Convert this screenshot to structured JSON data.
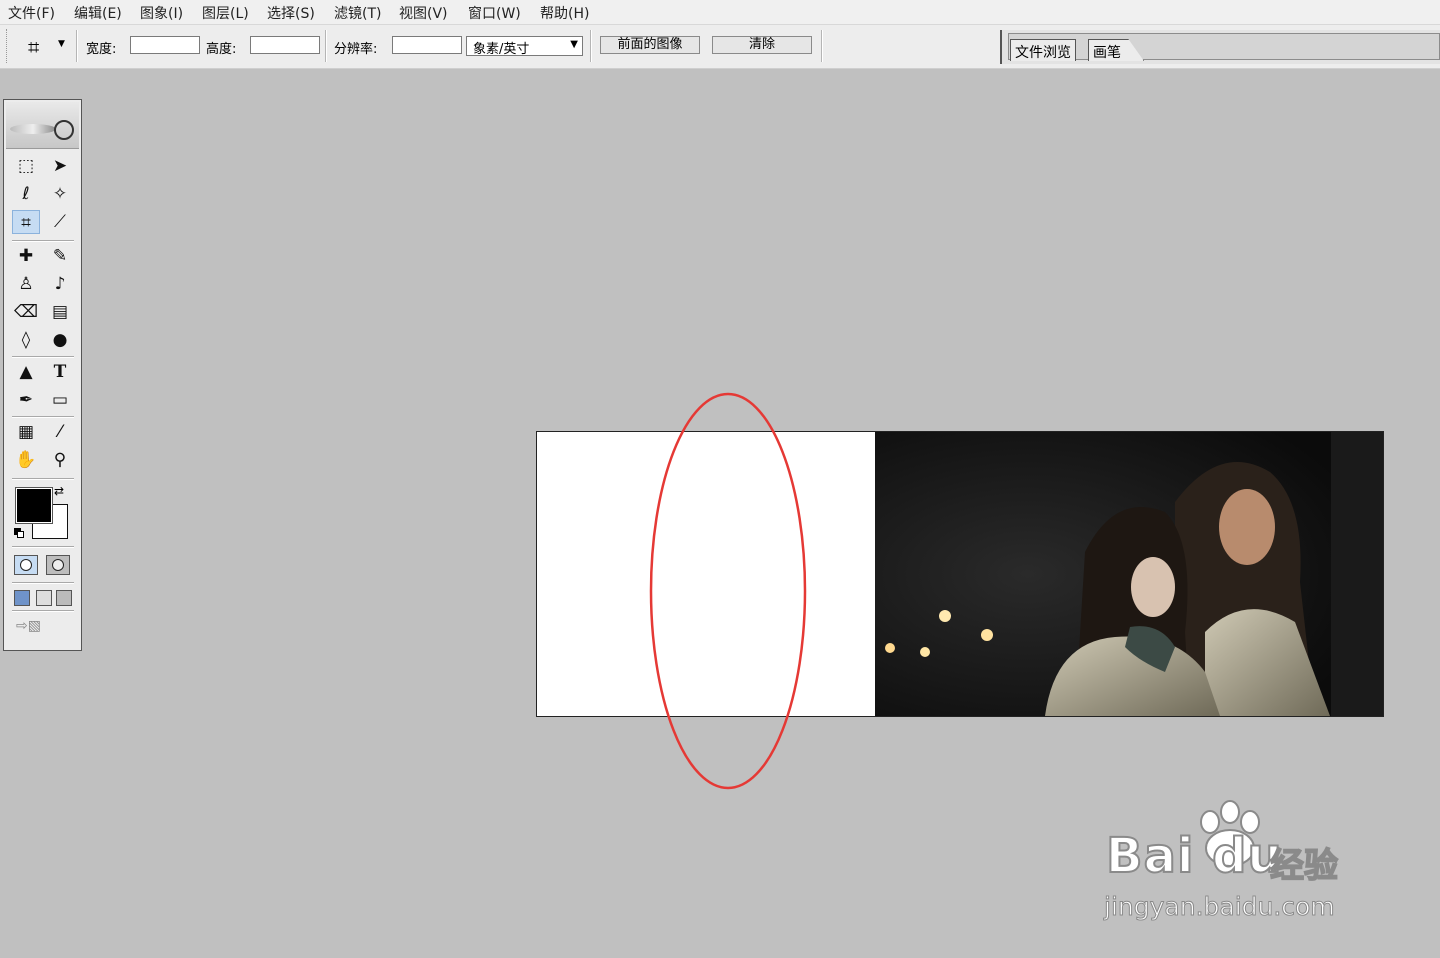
{
  "menu": {
    "items": [
      "文件(F)",
      "编辑(E)",
      "图象(I)",
      "图层(L)",
      "选择(S)",
      "滤镜(T)",
      "视图(V)",
      "窗口(W)",
      "帮助(H)"
    ]
  },
  "options": {
    "width_label": "宽度:",
    "width_value": "",
    "height_label": "高度:",
    "height_value": "",
    "resolution_label": "分辨率:",
    "resolution_value": "",
    "unit_selected": "象素/英寸",
    "front_image_label": "前面的图像",
    "clear_label": "清除"
  },
  "palette_well": {
    "tabs": [
      "文件浏览",
      "画笔"
    ]
  },
  "toolbox": {
    "foreground_color": "#000000",
    "background_color": "#ffffff",
    "tools": [
      "marquee-icon",
      "move-icon",
      "lasso-icon",
      "magic-wand-icon",
      "crop-icon",
      "slice-icon",
      "healing-brush-icon",
      "brush-icon",
      "clone-stamp-icon",
      "history-brush-icon",
      "eraser-icon",
      "gradient-icon",
      "blur-icon",
      "dodge-icon",
      "path-selection-icon",
      "type-icon",
      "pen-icon",
      "shape-icon",
      "notes-icon",
      "eyedropper-icon",
      "hand-icon",
      "zoom-icon"
    ]
  },
  "canvas": {
    "annotation_color": "#e53935"
  },
  "watermark": {
    "brand": "Bai du",
    "suffix": "经验",
    "url": "jingyan.baidu.com"
  }
}
